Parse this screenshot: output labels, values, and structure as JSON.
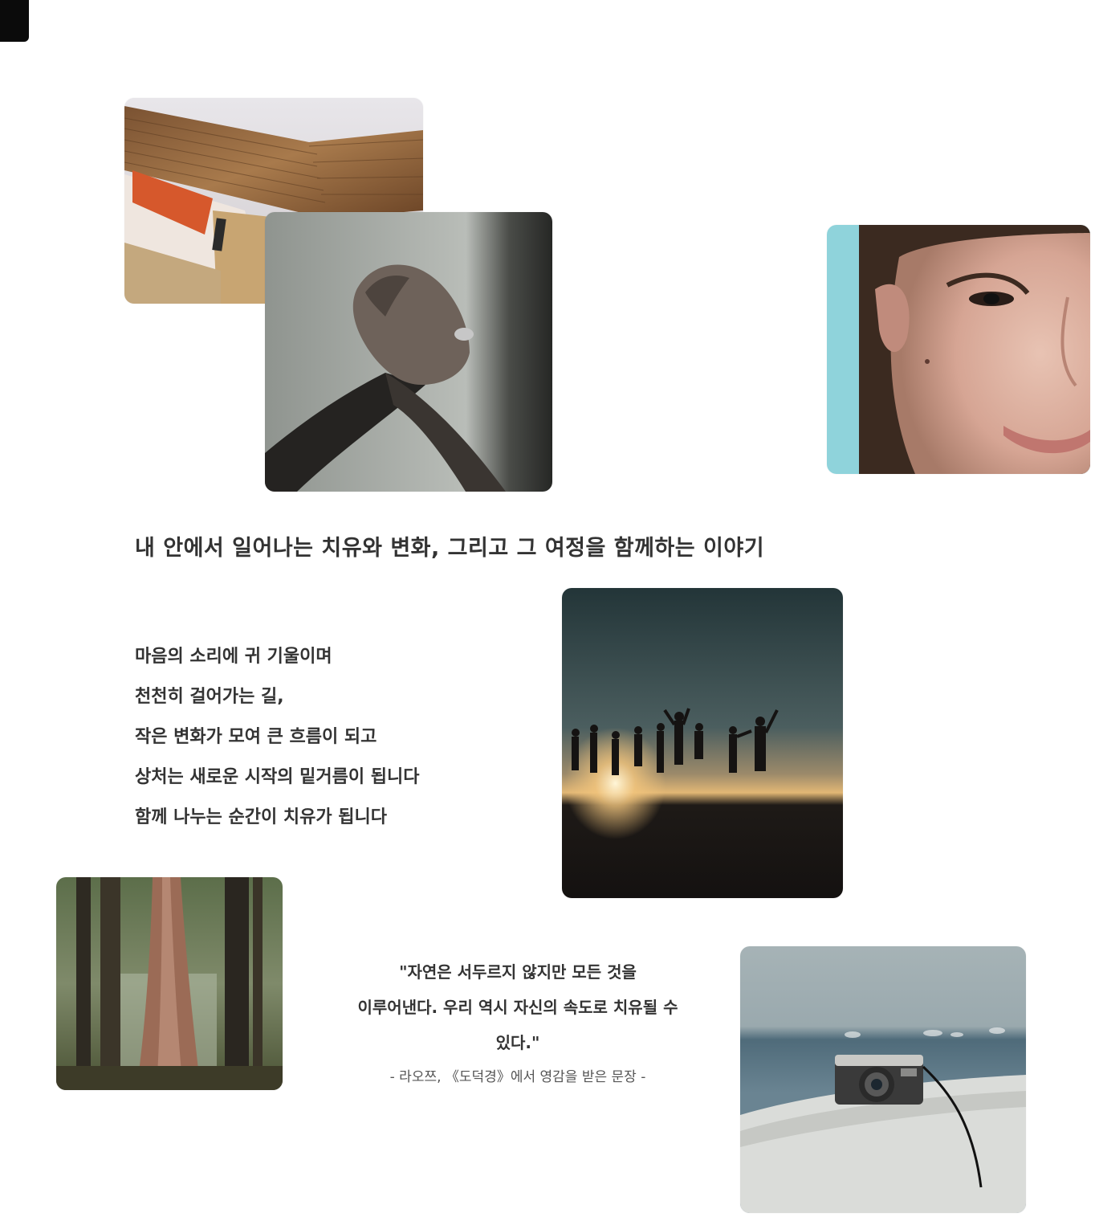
{
  "heading": "내 안에서 일어나는 치유와 변화, 그리고 그 여정을 함께하는 이야기",
  "paragraph": {
    "lines": [
      "마음의 소리에 귀 기울이며",
      "천천히 걸어가는 길,",
      "작은 변화가 모여 큰 흐름이 되고",
      "상처는 새로운 시작의 밑거름이 됩니다",
      "함께 나누는 순간이 치유가 됩니다"
    ]
  },
  "quote": {
    "lines": [
      "\"자연은 서두르지 않지만 모든 것을",
      "이루어낸다. 우리 역시 자신의 속도로 치유될 수",
      "있다.\""
    ],
    "attribution": "- 라오쯔, 《도덕경》에서 영감을 받은 문장 -"
  },
  "images": [
    {
      "name": "old-book-photo",
      "icon": "book-image"
    },
    {
      "name": "clasped-hands-photo",
      "icon": "hands-image"
    },
    {
      "name": "smiling-child-photo",
      "icon": "face-image"
    },
    {
      "name": "sunset-jumping-people-photo",
      "icon": "sunset-image"
    },
    {
      "name": "forest-trees-photo",
      "icon": "forest-image"
    },
    {
      "name": "camera-on-ledge-photo",
      "icon": "camera-image"
    }
  ]
}
